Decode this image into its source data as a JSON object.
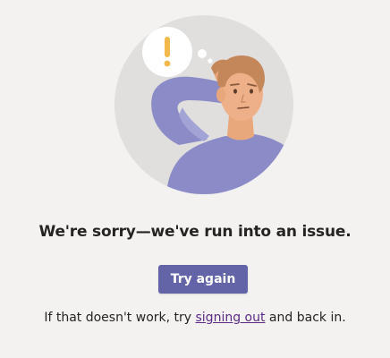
{
  "error": {
    "heading": "We're sorry—we've run into an issue.",
    "retry_label": "Try again",
    "hint_before": "If that doesn't work, try ",
    "hint_link": "signing out",
    "hint_after": " and back in."
  },
  "illustration": {
    "icon": "confused-person-illustration",
    "bubble_icon": "exclamation-icon",
    "colors": {
      "circle": "#e1dfdd",
      "shirt": "#8b8cc7",
      "skin": "#e8a87c",
      "hair": "#c4875a",
      "exclamation": "#f2b84b"
    }
  },
  "colors": {
    "background": "#f3f2f1",
    "accent": "#6264a7",
    "link": "#5b2a86",
    "text": "#252423"
  }
}
